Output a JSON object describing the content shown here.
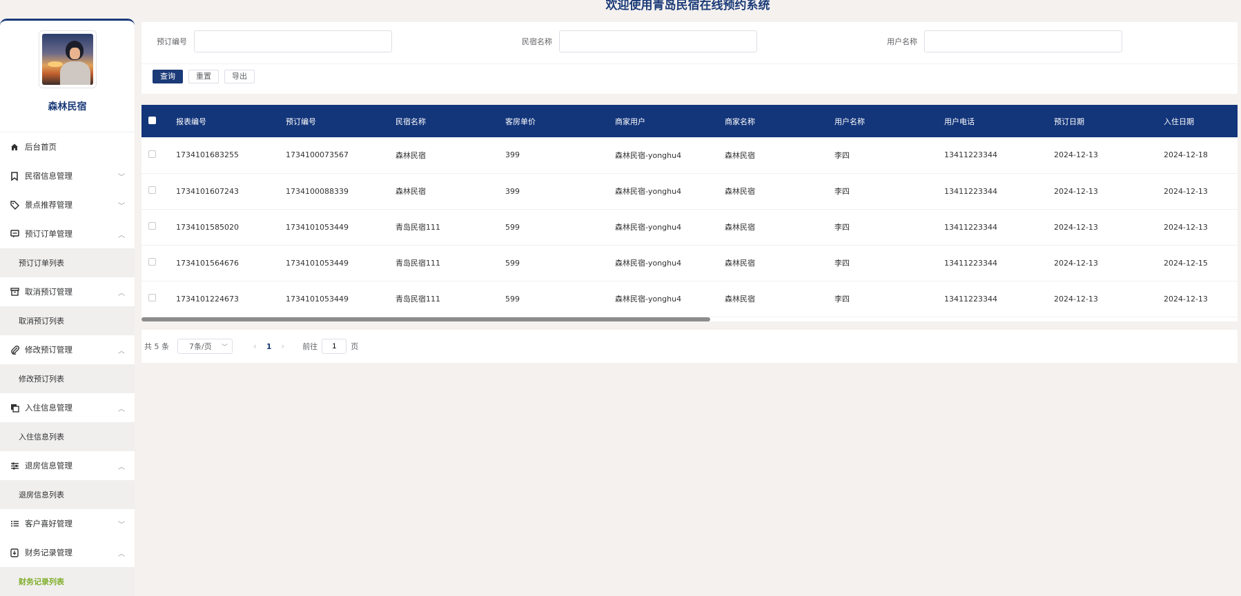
{
  "header": {
    "title": "欢迎使用青岛民宿在线预约系统"
  },
  "sidebar": {
    "profile_name": "森林民宿",
    "items": [
      {
        "label": "后台首页",
        "icon": "home-icon",
        "arrow": ""
      },
      {
        "label": "民宿信息管理",
        "icon": "bookmark-icon",
        "arrow": "﹀"
      },
      {
        "label": "景点推荐管理",
        "icon": "tag-icon",
        "arrow": "﹀"
      },
      {
        "label": "预订订单管理",
        "icon": "message-icon",
        "arrow": "︿",
        "sub": "预订订单列表"
      },
      {
        "label": "取消预订管理",
        "icon": "archive-icon",
        "arrow": "︿",
        "sub": "取消预订列表"
      },
      {
        "label": "修改预订管理",
        "icon": "paperclip-icon",
        "arrow": "︿",
        "sub": "修改预订列表"
      },
      {
        "label": "入住信息管理",
        "icon": "copy-icon",
        "arrow": "︿",
        "sub": "入住信息列表"
      },
      {
        "label": "退房信息管理",
        "icon": "sliders-icon",
        "arrow": "︿",
        "sub": "退房信息列表"
      },
      {
        "label": "客户喜好管理",
        "icon": "list-icon",
        "arrow": "﹀"
      },
      {
        "label": "财务记录管理",
        "icon": "download-doc-icon",
        "arrow": "︿",
        "sub": "财务记录列表"
      }
    ]
  },
  "search": {
    "field1_label": "预订编号",
    "field1_value": "",
    "field2_label": "民宿名称",
    "field2_value": "",
    "field3_label": "用户名称",
    "field3_value": "",
    "query_label": "查询",
    "reset_label": "重置",
    "export_label": "导出"
  },
  "table": {
    "columns": [
      "报表编号",
      "预订编号",
      "民宿名称",
      "客房单价",
      "商家用户",
      "商家名称",
      "用户名称",
      "用户电话",
      "预订日期",
      "入住日期"
    ],
    "rows": [
      [
        "1734101683255",
        "1734100073567",
        "森林民宿",
        "399",
        "森林民宿-yonghu4",
        "森林民宿",
        "李四",
        "13411223344",
        "2024-12-13",
        "2024-12-18"
      ],
      [
        "1734101607243",
        "1734100088339",
        "森林民宿",
        "399",
        "森林民宿-yonghu4",
        "森林民宿",
        "李四",
        "13411223344",
        "2024-12-13",
        "2024-12-13"
      ],
      [
        "1734101585020",
        "1734101053449",
        "青岛民宿111",
        "599",
        "森林民宿-yonghu4",
        "森林民宿",
        "李四",
        "13411223344",
        "2024-12-13",
        "2024-12-13"
      ],
      [
        "1734101564676",
        "1734101053449",
        "青岛民宿111",
        "599",
        "森林民宿-yonghu4",
        "森林民宿",
        "李四",
        "13411223344",
        "2024-12-13",
        "2024-12-15"
      ],
      [
        "1734101224673",
        "1734101053449",
        "青岛民宿111",
        "599",
        "森林民宿-yonghu4",
        "森林民宿",
        "李四",
        "13411223344",
        "2024-12-13",
        "2024-12-13"
      ]
    ]
  },
  "pagination": {
    "total": "共 5 条",
    "page_size": "7条/页",
    "prev": "‹",
    "current_page": "1",
    "next": "›",
    "goto_label": "前往",
    "goto_value": "1",
    "page_suffix": "页"
  },
  "colors": {
    "accent": "#1a3a78",
    "header_bg": "#13357a",
    "active_sub": "#7fae2b"
  }
}
